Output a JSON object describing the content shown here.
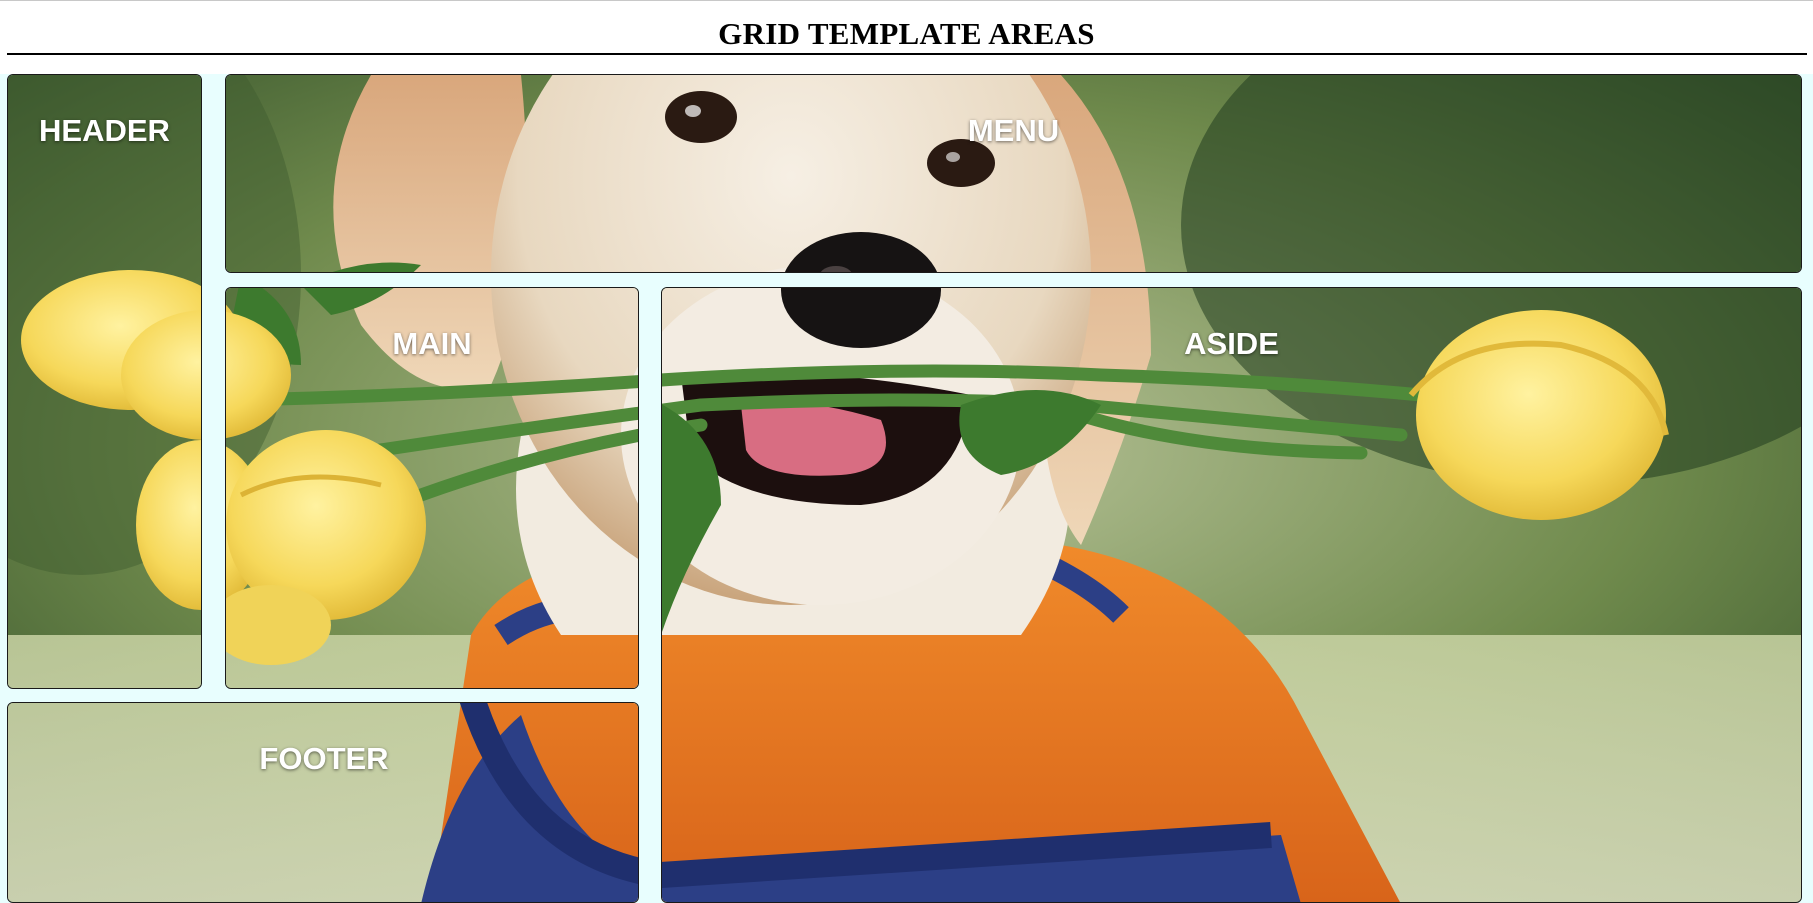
{
  "page": {
    "title": "GRID TEMPLATE AREAS"
  },
  "areas": {
    "header": "HEADER",
    "menu": "MENU",
    "main": "MAIN",
    "aside": "ASIDE",
    "footer": "FOOTER"
  },
  "colors": {
    "grid_background": "#e8fefe",
    "cell_border": "#1a1a1a",
    "label": "#ffffff"
  },
  "image": {
    "subject": "puppy-holding-yellow-roses-photo"
  }
}
